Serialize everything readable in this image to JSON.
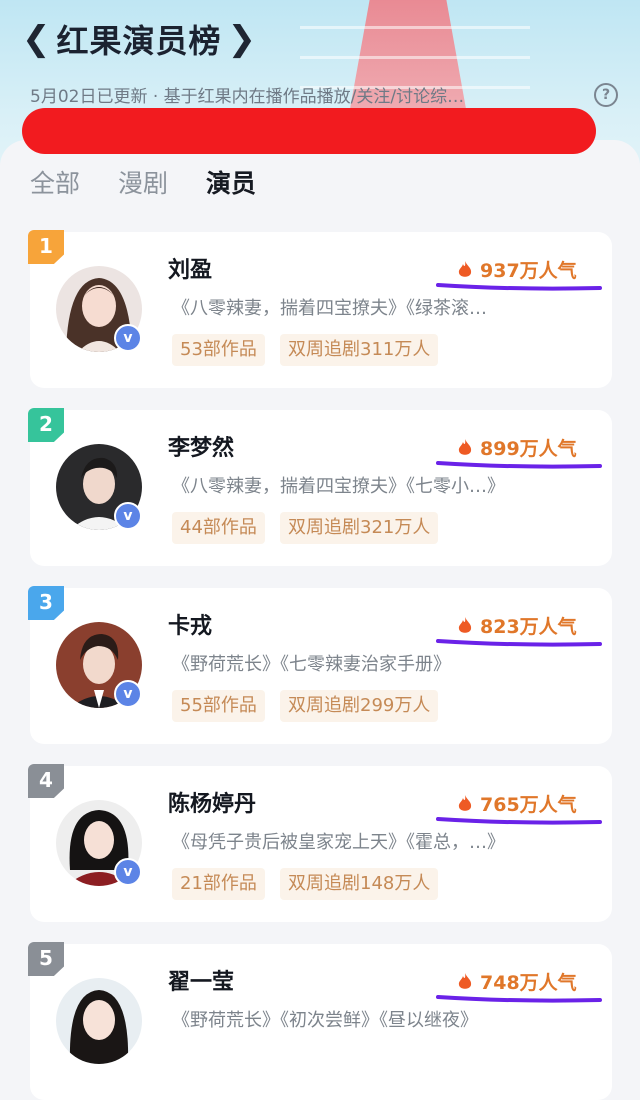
{
  "header": {
    "title": "红果演员榜",
    "laurel_left": "❮",
    "laurel_right": "❯",
    "subtitle": "5月02日已更新 · 基于红果内在播作品播放/关注/讨论综…",
    "help_icon": "?"
  },
  "tabs": [
    {
      "label": "全部",
      "active": false
    },
    {
      "label": "漫剧",
      "active": false
    },
    {
      "label": "演员",
      "active": true
    }
  ],
  "colors": {
    "rank1": "#f7a43a",
    "rank2": "#36c49b",
    "rank3": "#4aa7ec",
    "rank4": "#8a8f96",
    "rank5": "#8a8f96",
    "popularity": "#e0772a",
    "redaction": "#f21b1f",
    "annotation": "#6a22e8"
  },
  "actors": [
    {
      "rank": "1",
      "name": "刘盈",
      "popularity": "937万人气",
      "works": "《八零辣妻，揣着四宝撩夫》《绿茶滚…",
      "count": "53部作品",
      "followers": "双周追剧311万人"
    },
    {
      "rank": "2",
      "name": "李梦然",
      "popularity": "899万人气",
      "works": "《八零辣妻，揣着四宝撩夫》《七零小…》",
      "count": "44部作品",
      "followers": "双周追剧321万人"
    },
    {
      "rank": "3",
      "name": "卡戎",
      "popularity": "823万人气",
      "works": "《野荷荒长》《七零辣妻治家手册》",
      "count": "55部作品",
      "followers": "双周追剧299万人"
    },
    {
      "rank": "4",
      "name": "陈杨婷丹",
      "popularity": "765万人气",
      "works": "《母凭子贵后被皇家宠上天》《霍总，…》",
      "count": "21部作品",
      "followers": "双周追剧148万人"
    },
    {
      "rank": "5",
      "name": "翟一莹",
      "popularity": "748万人气",
      "works": "《野荷荒长》《初次尝鲜》《昼以继夜》",
      "count": "",
      "followers": ""
    }
  ],
  "verified_mark": "v"
}
